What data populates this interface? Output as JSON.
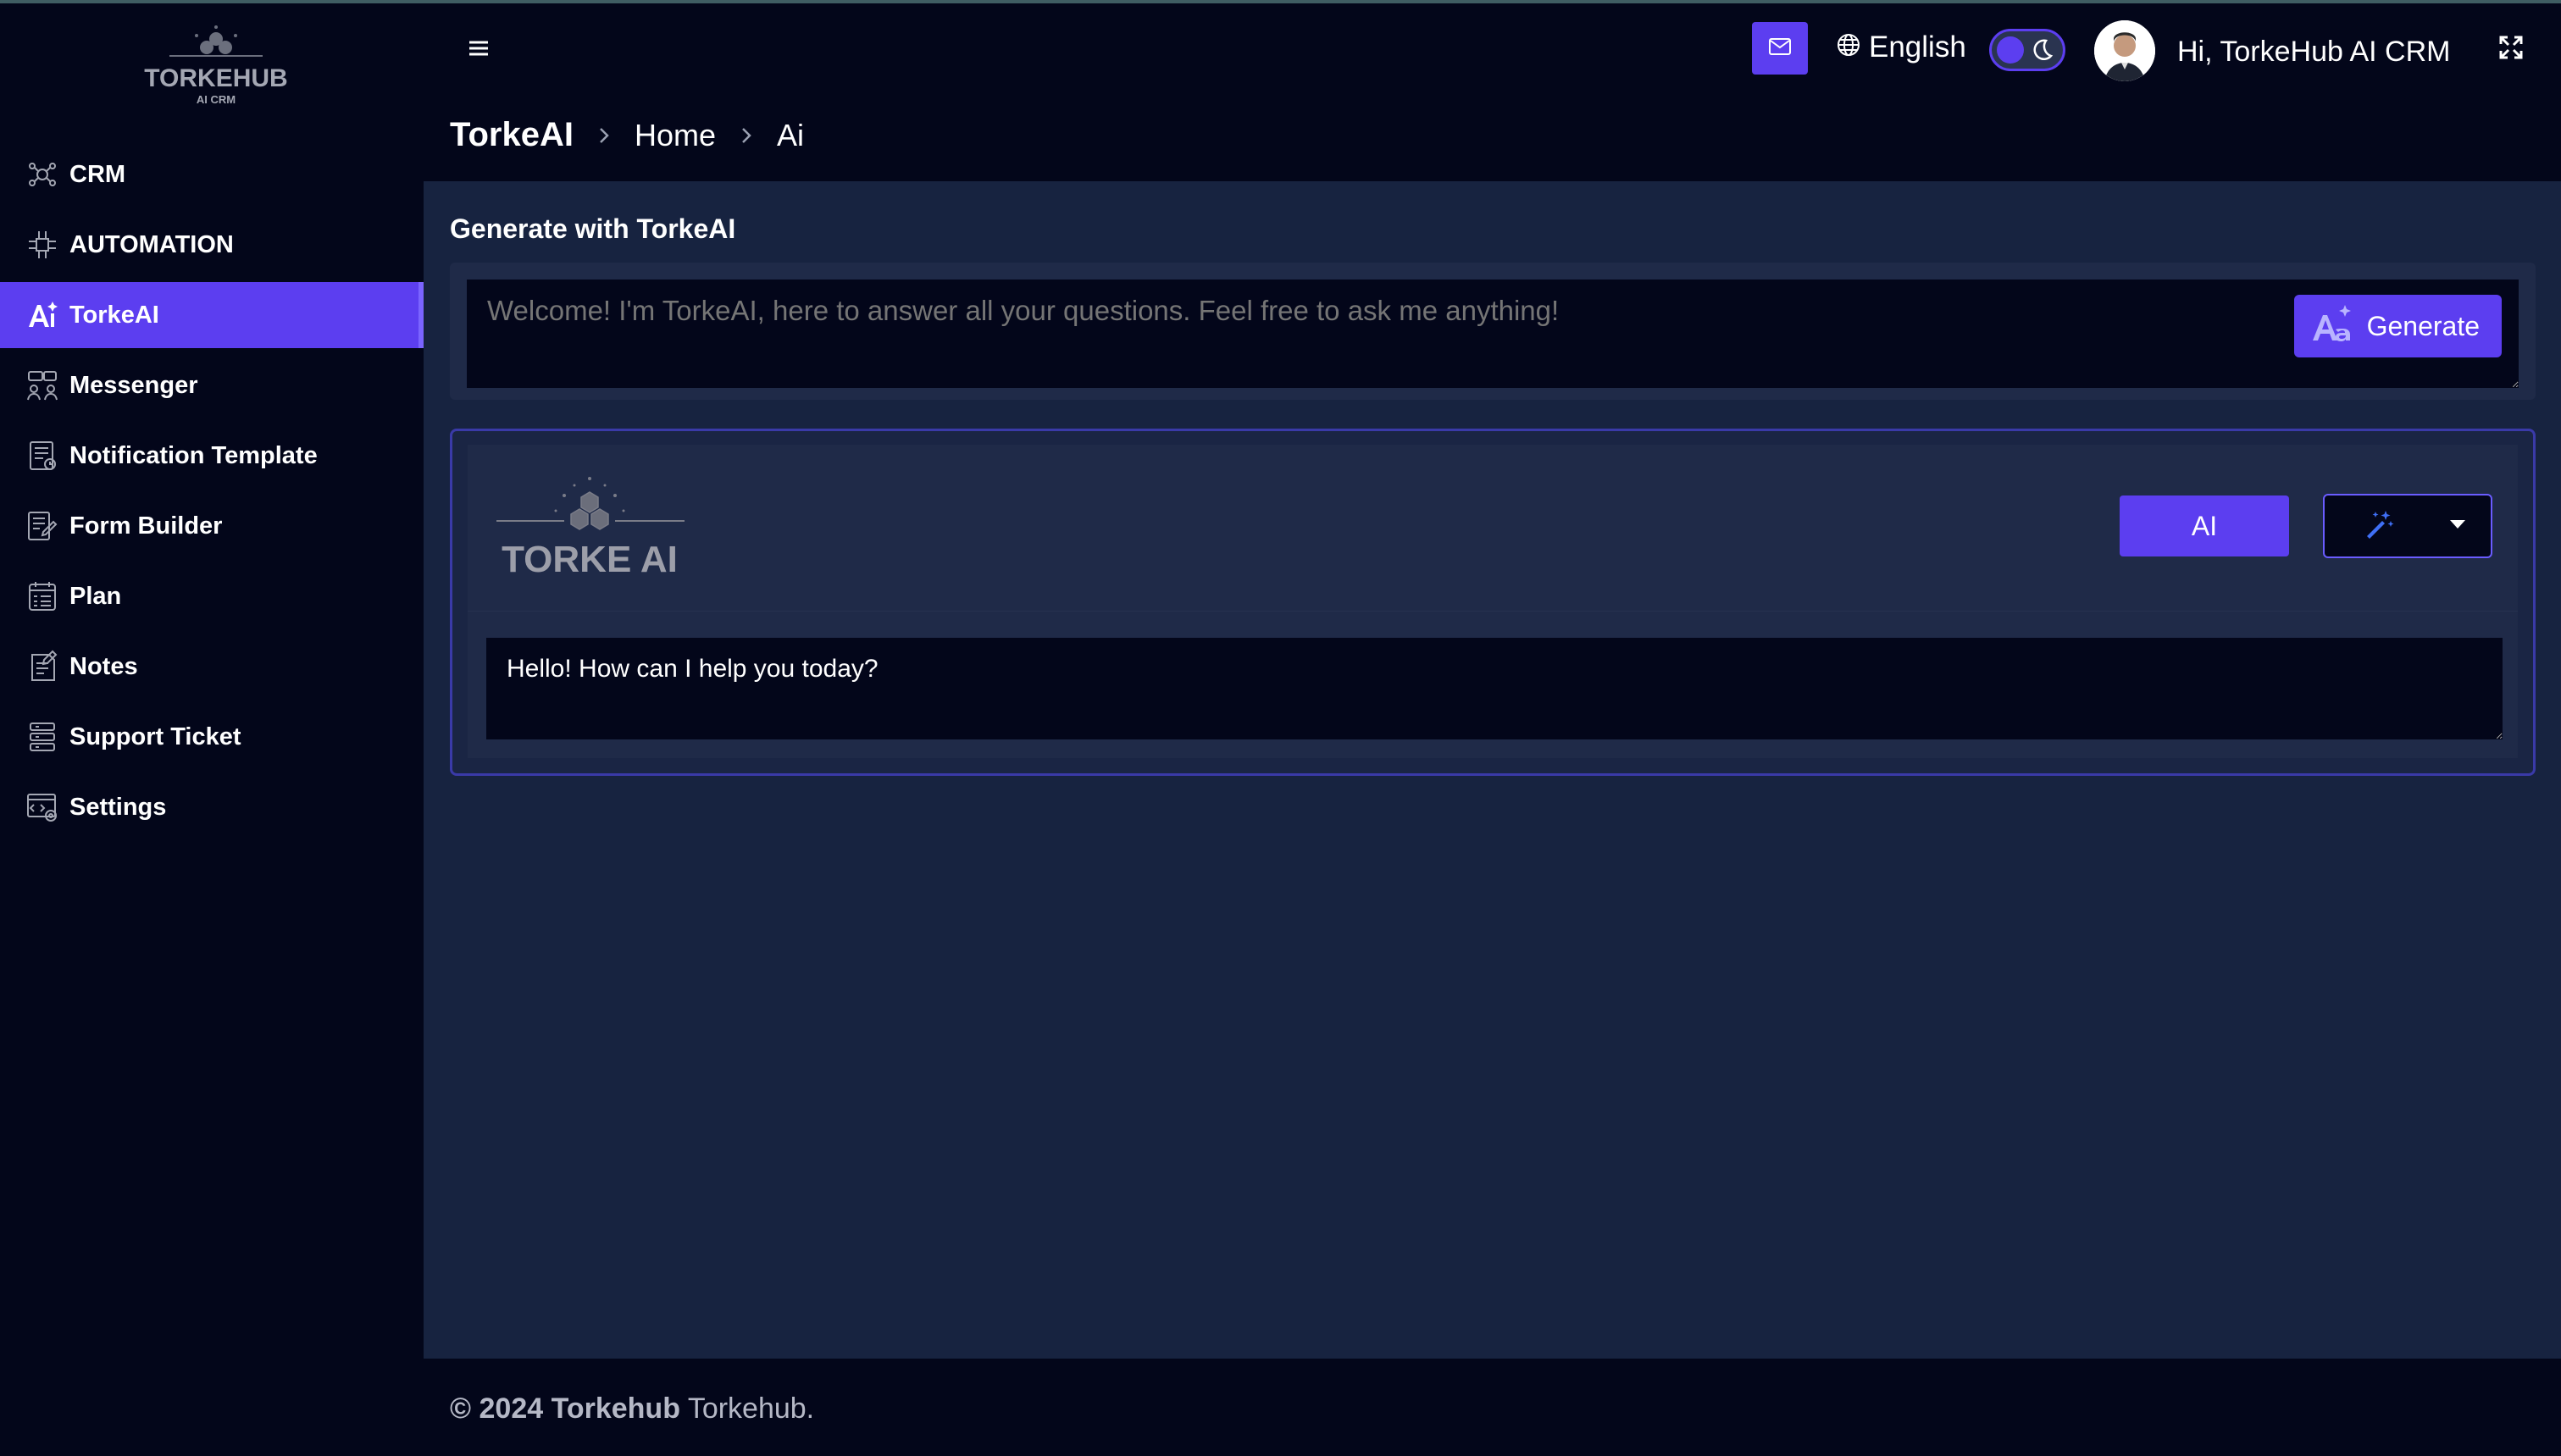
{
  "brand": {
    "logo_text": "TORKEHUB",
    "logo_subtext": "AI CRM"
  },
  "sidebar": {
    "items": [
      {
        "label": "CRM",
        "icon": "network-icon",
        "active": false
      },
      {
        "label": "AUTOMATION",
        "icon": "circuit-icon",
        "active": false
      },
      {
        "label": "TorkeAI",
        "icon": "ai-text-icon",
        "active": true
      },
      {
        "label": "Messenger",
        "icon": "people-chat-icon",
        "active": false
      },
      {
        "label": "Notification Template",
        "icon": "template-icon",
        "active": false
      },
      {
        "label": "Form Builder",
        "icon": "form-edit-icon",
        "active": false
      },
      {
        "label": "Plan",
        "icon": "plan-icon",
        "active": false
      },
      {
        "label": "Notes",
        "icon": "notes-icon",
        "active": false
      },
      {
        "label": "Support Ticket",
        "icon": "ticket-icon",
        "active": false
      },
      {
        "label": "Settings",
        "icon": "settings-code-icon",
        "active": false
      }
    ]
  },
  "header": {
    "language": "English",
    "greeting": "Hi, TorkeHub AI CRM",
    "theme": "dark"
  },
  "breadcrumb": {
    "title": "TorkeAI",
    "items": [
      "Home",
      "Ai"
    ]
  },
  "main": {
    "section_title": "Generate with TorkeAI",
    "prompt_placeholder": "Welcome! I'm TorkeAI, here to answer all your questions. Feel free to ask me anything!",
    "generate_label": "Generate",
    "chat_logo_text": "TORKE AI",
    "ai_button_label": "AI",
    "reply_text": "Hello! How can I help you today?"
  },
  "footer": {
    "year": "© 2024",
    "brand": "Torkehub",
    "suffix": "Torkehub."
  },
  "colors": {
    "accent": "#5c3ef0",
    "background": "#03061a",
    "panel": "#172340"
  }
}
